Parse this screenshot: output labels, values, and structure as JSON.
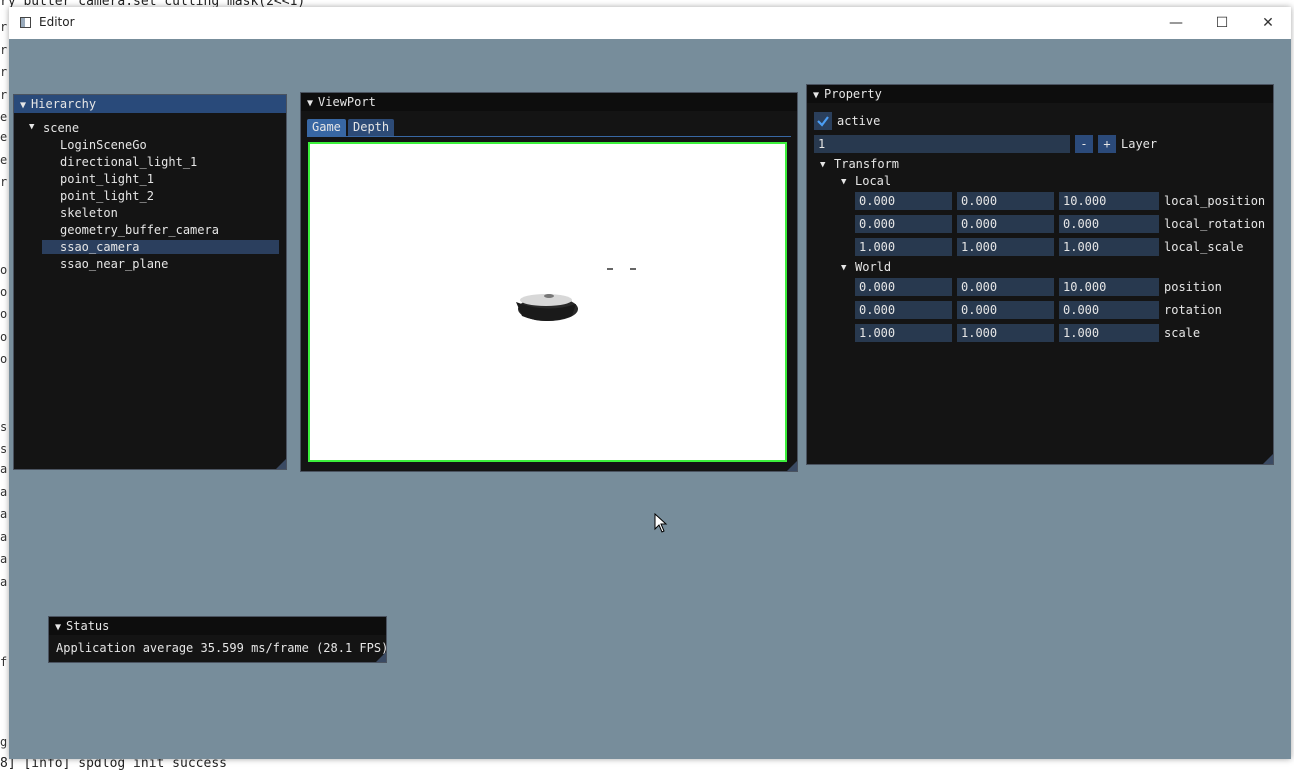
{
  "background": {
    "top_line": "ry_butter_camera:set_culling_mask(2<<1)",
    "bottom_line": "8] [info] spdlog init success",
    "left_fragments": [
      "r",
      "r",
      "r",
      "r",
      "e",
      "e",
      "e",
      "r",
      "o",
      "o",
      "o",
      "o",
      "o",
      "s",
      "s",
      "a",
      "a",
      "a",
      "a",
      "a",
      "a",
      "f",
      "g"
    ]
  },
  "window": {
    "title": "Editor",
    "controls": {
      "minimize": "—",
      "maximize": "☐",
      "close": "✕"
    }
  },
  "hierarchy": {
    "title": "Hierarchy",
    "root": "scene",
    "items": [
      "LoginSceneGo",
      "directional_light_1",
      "point_light_1",
      "point_light_2",
      "skeleton",
      "geometry_buffer_camera",
      "ssao_camera",
      "ssao_near_plane"
    ],
    "selected": "ssao_camera"
  },
  "viewport": {
    "title": "ViewPort",
    "tabs": [
      "Game",
      "Depth"
    ],
    "active_tab": "Game"
  },
  "property": {
    "title": "Property",
    "active_label": "active",
    "active_checked": true,
    "layer_value": "1",
    "layer_minus": "-",
    "layer_plus": "+",
    "layer_label": "Layer",
    "transform_label": "Transform",
    "local_label": "Local",
    "world_label": "World",
    "local_position": {
      "x": "0.000",
      "y": "0.000",
      "z": "10.000",
      "label": "local_position"
    },
    "local_rotation": {
      "x": "0.000",
      "y": "0.000",
      "z": "0.000",
      "label": "local_rotation"
    },
    "local_scale": {
      "x": "1.000",
      "y": "1.000",
      "z": "1.000",
      "label": "local_scale"
    },
    "position": {
      "x": "0.000",
      "y": "0.000",
      "z": "10.000",
      "label": "position"
    },
    "rotation": {
      "x": "0.000",
      "y": "0.000",
      "z": "0.000",
      "label": "rotation"
    },
    "scale": {
      "x": "1.000",
      "y": "1.000",
      "z": "1.000",
      "label": "scale"
    }
  },
  "status": {
    "title": "Status",
    "text": "Application average 35.599 ms/frame (28.1 FPS)"
  }
}
